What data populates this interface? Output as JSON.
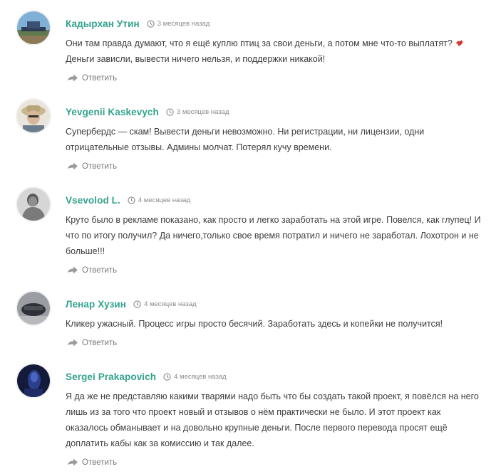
{
  "colors": {
    "author": "#32a28d",
    "text": "#3d3d3d",
    "meta": "#8a8a8a",
    "reply": "#7a7a7a"
  },
  "comments": [
    {
      "author": "Кадырхан Утин",
      "date": "3 месяцев назад",
      "lines": [
        "Они там правда думают, что я ещё куплю птиц за свои деньги, а потом мне что-то выплатят?",
        "Деньги зависли, вывести ничего нельзя, и поддержки никакой!"
      ],
      "emoji": "bird-icon",
      "reply": "Ответить"
    },
    {
      "author": "Yevgenii Kaskevych",
      "date": "3 месяцев назад",
      "lines": [
        "Супербердс — скам! Вывести деньги невозможно. Ни регистрации, ни лицензии, одни",
        "отрицательные отзывы. Админы молчат. Потерял кучу времени."
      ],
      "reply": "Ответить"
    },
    {
      "author": "Vsevolod L.",
      "date": "4 месяцев назад",
      "lines": [
        "Круто было в рекламе показано, как просто и легко заработать на этой игре. Повелся, как глупец! И",
        "что по итогу получил? Да ничего,только свое время потратил и ничего не заработал. Лохотрон и не",
        "больше!!!"
      ],
      "reply": "Ответить"
    },
    {
      "author": "Ленар Хузин",
      "date": "4 месяцев назад",
      "lines": [
        "Кликер ужасный. Процесс игры просто бесячий. Заработать здесь и копейки не получится!"
      ],
      "reply": "Ответить"
    },
    {
      "author": "Sergei Prakapovich",
      "date": "4 месяцев назад",
      "lines": [
        "Я да же не представляю какими тварями надо быть что бы создать такой проект, я повёлся на него",
        "лишь из за того что проект новый и отзывов о нём практически не было. И этот проект как",
        "оказалось обманывает и на довольно крупные деньги. После первого перевода просят ещё",
        "доплатить кабы как за комиссию и так далее."
      ],
      "reply": "Ответить"
    }
  ]
}
